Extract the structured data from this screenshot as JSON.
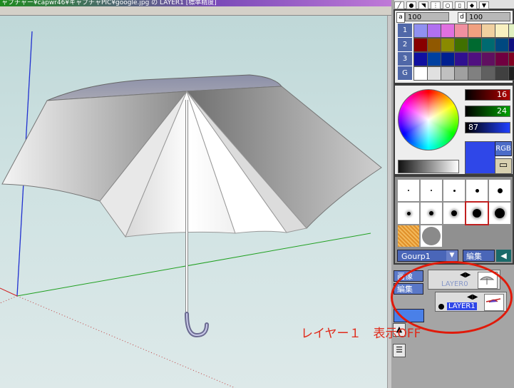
{
  "window": {
    "title": "ャプチャー¥capwr46¥キャプチャPIC¥google.jpg の LAYER1 [標準精度]"
  },
  "colors": {
    "accent": "#4a66b8",
    "selected_color": "#2f47e8",
    "annotation": "#e01a0a"
  },
  "toolbar": {
    "tools": [
      "pen-icon",
      "dot-icon",
      "bucket-icon",
      "select-icon",
      "blur-icon",
      "eraser-icon",
      "fill-icon",
      "down-arrow-icon"
    ]
  },
  "brush_settings": {
    "a_label": "a",
    "a_value": "100",
    "d_label": "d",
    "d_value": "100"
  },
  "palette": {
    "rows": [
      {
        "label": "1",
        "colors": [
          "#9090f0",
          "#b070f0",
          "#e070e0",
          "#f090a0",
          "#f0a080",
          "#f0d0a0",
          "#f8f0c0",
          "#e0f0c0"
        ]
      },
      {
        "label": "2",
        "colors": [
          "#880000",
          "#905800",
          "#8a8a00",
          "#407000",
          "#006a30",
          "#006a70",
          "#004880",
          "#101080"
        ]
      },
      {
        "label": "3",
        "colors": [
          "#1010a0",
          "#0040a0",
          "#002090",
          "#301090",
          "#501080",
          "#601060",
          "#700040",
          "#800020"
        ]
      },
      {
        "label": "G",
        "colors": [
          "#ffffff",
          "#e0e0e0",
          "#c0c0c0",
          "#a0a0a0",
          "#808080",
          "#606060",
          "#404040",
          "#202020"
        ]
      }
    ]
  },
  "color_picker": {
    "r": "16",
    "g": "24",
    "b": "87",
    "mode_button": "RGB"
  },
  "brushes": {
    "group_name": "Gourp1",
    "edit_label": "編集"
  },
  "layers": {
    "side_buttons": [
      "画像",
      "編集"
    ],
    "items": [
      {
        "name": "LAYER0",
        "visible": true
      },
      {
        "name": "LAYER1",
        "visible": false
      }
    ]
  },
  "annotation": {
    "text": "レイヤー１　表示OFF"
  }
}
